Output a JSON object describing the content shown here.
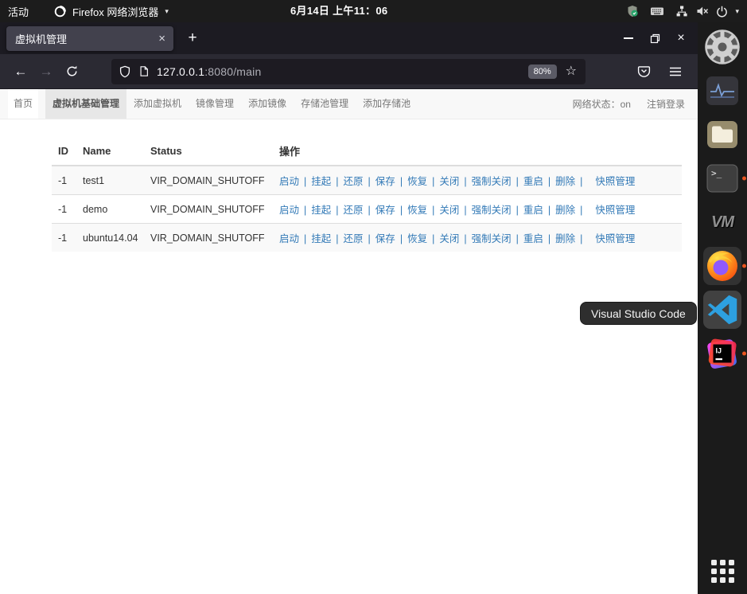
{
  "topbar": {
    "activities": "活动",
    "app_menu": "Firefox 网络浏览器",
    "clock": "6月14日 上午11：06"
  },
  "browser": {
    "tab_title": "虚拟机管理",
    "url_host": "127.0.0.1",
    "url_path": ":8080/main",
    "zoom_level": "80%"
  },
  "page": {
    "nav": {
      "items": [
        {
          "id": "home",
          "label": "首页",
          "brand": true
        },
        {
          "id": "vm-management",
          "label": "虚拟机基础管理",
          "active": true
        },
        {
          "id": "add-vm",
          "label": "添加虚拟机"
        },
        {
          "id": "image-management",
          "label": "镜像管理"
        },
        {
          "id": "add-image",
          "label": "添加镜像"
        },
        {
          "id": "storage-pool-management",
          "label": "存储池管理"
        },
        {
          "id": "add-storage-pool",
          "label": "添加存储池"
        }
      ],
      "network_status_label": "网络状态：",
      "network_status_value": "on",
      "logout": "注销登录"
    },
    "table": {
      "headers": [
        "ID",
        "Name",
        "Status",
        "操作"
      ],
      "actions": [
        "启动",
        "挂起",
        "还原",
        "保存",
        "恢复",
        "关闭",
        "强制关闭",
        "重启",
        "删除"
      ],
      "snapshot_action": "快照管理",
      "rows": [
        {
          "id": "-1",
          "name": "test1",
          "status": "VIR_DOMAIN_SHUTOFF"
        },
        {
          "id": "-1",
          "name": "demo",
          "status": "VIR_DOMAIN_SHUTOFF"
        },
        {
          "id": "-1",
          "name": "ubuntu14.04",
          "status": "VIR_DOMAIN_SHUTOFF"
        }
      ]
    }
  },
  "dock": {
    "tooltip": "Visual Studio Code",
    "vm_logo_text": "VM",
    "items": [
      {
        "id": "settings",
        "icon": "gear-icon",
        "running": false
      },
      {
        "id": "system-monitor",
        "icon": "activity-monitor-icon",
        "running": false
      },
      {
        "id": "files",
        "icon": "folder-icon",
        "running": false
      },
      {
        "id": "terminal",
        "icon": "terminal-icon",
        "running": true
      },
      {
        "id": "vmware",
        "icon": "vm-logo-icon",
        "running": false
      },
      {
        "id": "firefox",
        "icon": "firefox-icon",
        "running": true
      },
      {
        "id": "vscode",
        "icon": "vscode-icon",
        "running": false,
        "hovered": true
      },
      {
        "id": "intellij",
        "icon": "intellij-icon",
        "running": true
      }
    ]
  },
  "colors": {
    "link_blue": "#337ab7",
    "ubuntu_orange": "#e95420",
    "navbar_bg": "#f8f8f8",
    "navbar_active_bg": "#e7e7e7",
    "striped_row_bg": "#f9f9f9",
    "topbar_bg": "#1c1c1c",
    "tabbar_bg": "#1c1b22",
    "active_tab_bg": "#42414d",
    "toolbar_bg": "#2b2a33",
    "urlbar_bg": "#1d1b22",
    "status_green": "#26a269"
  }
}
